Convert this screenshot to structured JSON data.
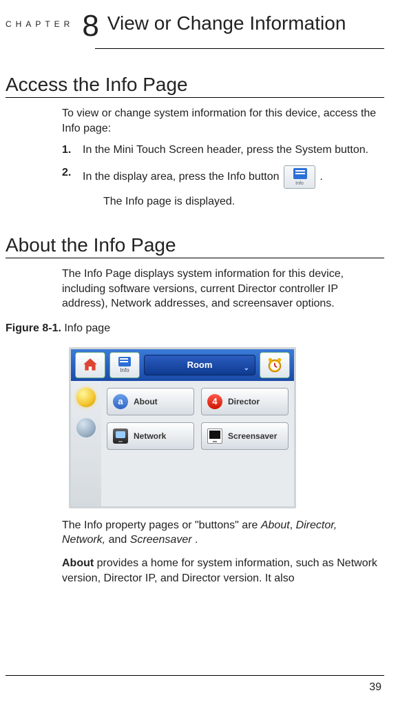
{
  "chapter": {
    "label": "CHAPTER",
    "number": "8",
    "title": "View or Change Information"
  },
  "sections": {
    "access": {
      "title": "Access the Info Page",
      "intro": "To view or change system information for this device, access the Info page:",
      "steps": [
        {
          "num": "1.",
          "text": "In the Mini Touch Screen header, press the System button."
        },
        {
          "num": "2.",
          "text_before": "In the display area, press the Info button ",
          "text_after": ".",
          "icon_label": "Info"
        }
      ],
      "result": "The Info page is displayed."
    },
    "about": {
      "title": "About the Info Page",
      "intro": "The Info Page displays system information for this device, including software versions, current Director controller IP address), Network addresses, and screensaver options.",
      "figure": {
        "label": "Figure 8-1.",
        "caption": "Info page",
        "topbar": {
          "room_label": "Room",
          "info_label": "Info"
        },
        "buttons": [
          {
            "label": "About"
          },
          {
            "label": "Director"
          },
          {
            "label": "Network"
          },
          {
            "label": "Screensaver"
          }
        ]
      },
      "para_buttons_before": "The Info property pages or \"buttons\" are ",
      "para_buttons_items": [
        "About",
        "Director,",
        "Network,",
        "Screensaver"
      ],
      "para_buttons_and": " and ",
      "para_buttons_after": ".",
      "para_about_title": "About",
      "para_about_text": " provides a home for system information, such as Network version, Director IP, and Director version. It also"
    }
  },
  "page_number": "39"
}
